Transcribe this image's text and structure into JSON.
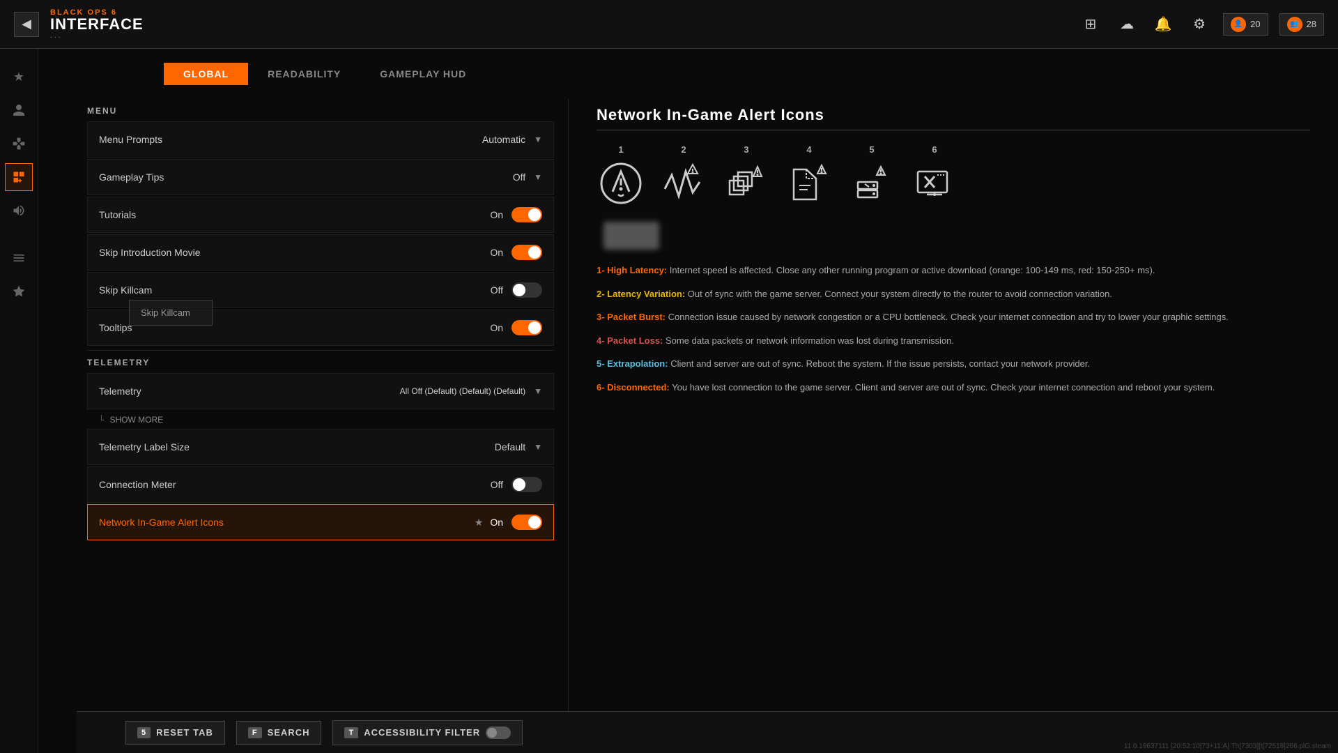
{
  "header": {
    "back_label": "◀",
    "logo_top": "BLACK OPS 6",
    "logo_bottom": "INTERFACE",
    "logo_sub": "...",
    "icons": [
      "⊞",
      "☁",
      "🔔",
      "⚙"
    ],
    "user_badge_count": "20",
    "friends_count": "28"
  },
  "sidebar": {
    "items": [
      {
        "icon": "★",
        "name": "favorites",
        "active": false
      },
      {
        "icon": "👤",
        "name": "profile",
        "active": false
      },
      {
        "icon": "🎮",
        "name": "gameplay",
        "active": false
      },
      {
        "icon": "✏",
        "name": "interface",
        "active": true
      },
      {
        "icon": "🔊",
        "name": "audio",
        "active": false
      },
      {
        "icon": "☰",
        "name": "menu2",
        "active": false
      },
      {
        "icon": "⬡",
        "name": "extra",
        "active": false
      }
    ]
  },
  "tabs": [
    {
      "label": "GLOBAL",
      "active": true
    },
    {
      "label": "READABILITY",
      "active": false
    },
    {
      "label": "GAMEPLAY HUD",
      "active": false
    }
  ],
  "menu_section": {
    "title": "MENU",
    "settings": [
      {
        "name": "Menu Prompts",
        "value": "Automatic",
        "type": "dropdown",
        "highlighted": false
      },
      {
        "name": "Gameplay Tips",
        "value": "Off",
        "type": "dropdown",
        "highlighted": false
      },
      {
        "name": "Tutorials",
        "value": "On",
        "type": "toggle",
        "toggle_on": true,
        "highlighted": false
      },
      {
        "name": "Skip Introduction Movie",
        "value": "On",
        "type": "toggle",
        "toggle_on": true,
        "highlighted": false
      },
      {
        "name": "Skip Killcam",
        "value": "Off",
        "type": "toggle",
        "toggle_on": false,
        "highlighted": false
      },
      {
        "name": "Tooltips",
        "value": "On",
        "type": "toggle",
        "toggle_on": true,
        "highlighted": false
      }
    ]
  },
  "telemetry_section": {
    "title": "TELEMETRY",
    "settings": [
      {
        "name": "Telemetry",
        "value": "All Off (Default) (Default) (Default)",
        "type": "dropdown",
        "highlighted": false
      },
      {
        "name": "Telemetry Label Size",
        "value": "Default",
        "type": "dropdown",
        "highlighted": false
      },
      {
        "name": "Connection Meter",
        "value": "Off",
        "type": "toggle",
        "toggle_on": false,
        "highlighted": false
      },
      {
        "name": "Network In-Game Alert Icons",
        "value": "On",
        "type": "toggle",
        "toggle_on": true,
        "highlighted": true,
        "starred": true
      }
    ],
    "show_more_label": "SHOW MORE"
  },
  "right_panel": {
    "title": "Network In-Game Alert Icons",
    "icons": [
      {
        "number": "1",
        "desc": "High Latency"
      },
      {
        "number": "2",
        "desc": "Latency Variation"
      },
      {
        "number": "3",
        "desc": "Packet Burst"
      },
      {
        "number": "4",
        "desc": "Packet Loss"
      },
      {
        "number": "5",
        "desc": "Extrapolation"
      },
      {
        "number": "6",
        "desc": "Disconnected"
      }
    ],
    "descriptions": [
      {
        "number": "1",
        "label": "High Latency",
        "label_color": "orange",
        "text": "Internet speed is affected. Close any other running program or active download (orange: 100-149 ms, red: 150-250+ ms)."
      },
      {
        "number": "2",
        "label": "Latency Variation",
        "label_color": "yellow",
        "text": "Out of sync with the game server. Connect your system directly to the router to avoid connection variation."
      },
      {
        "number": "3",
        "label": "Packet Burst",
        "label_color": "orange",
        "text": "Connection issue caused by network congestion or a CPU bottleneck. Check your internet connection and try to lower your graphic settings."
      },
      {
        "number": "4",
        "label": "Packet Loss",
        "label_color": "red",
        "text": "Some data packets or network information was lost during transmission."
      },
      {
        "number": "5",
        "label": "Extrapolation",
        "label_color": "blue",
        "text": "Client and server are out of sync. Reboot the system. If the issue persists, contact your network provider."
      },
      {
        "number": "6",
        "label": "Disconnected",
        "label_color": "orange",
        "text": "You have lost connection to the game server. Client and server are out of sync. Check your internet connection and reboot your system."
      }
    ]
  },
  "bottom_bar": {
    "reset_key": "5",
    "reset_label": "RESET TAB",
    "search_key": "F",
    "search_label": "SEARCH",
    "accessibility_key": "T",
    "accessibility_label": "ACCESSIBILITY FILTER"
  },
  "version": "11.0.19637111 [20:52:10|73+11:A] Th[7303][t[72518]266.plG.steam"
}
